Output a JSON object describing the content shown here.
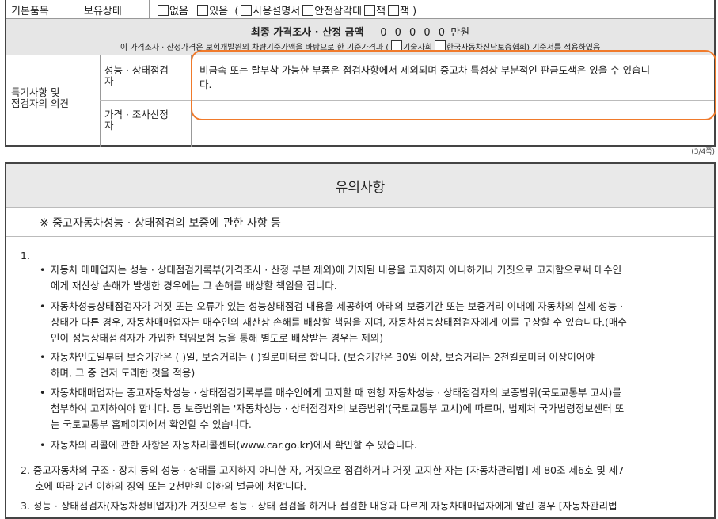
{
  "row1": {
    "label": "기본품목",
    "sublabel": "보유상태",
    "opt_none": "없음",
    "opt_have": "있음",
    "paren_open": "(",
    "item_manual": "사용설명서",
    "item_triangle": "안전삼각대",
    "item_jack": "잭",
    "item_jack2": "잭",
    "paren_close": ")"
  },
  "price": {
    "title": "최종 가격조사 · 산정 금액",
    "amount": "0 0 0 0 0",
    "unit": "만원",
    "note_prefix": "이 가격조사 · 산정가격은 보험개발원의 차량기준가액을 바탕으로 한 기준가격과 (",
    "opt_tech": "기술사회",
    "opt_assoc": "한국자동차진단보증협회",
    "note_suffix": ") 기준서를 적용하였음"
  },
  "special": {
    "label_line1": "특기사항 및",
    "label_line2": "점검자의 의견",
    "perf_label_line1": "성능 · 상태점검",
    "perf_label_line2": "자",
    "perf_text_line1": "비금속 또는 탈부착 가능한 부품은 점검사항에서 제외되며 중고차 특성상 부분적인 판금도색은 있을 수 있습니",
    "perf_text_line2": "다.",
    "price_label_line1": "가격 · 조사산정",
    "price_label_line2": "자",
    "price_text": ""
  },
  "page_num": "(3/4쪽)",
  "notice": {
    "title": "유의사항",
    "subtitle": "※ 중고자동차성능 · 상태점검의 보증에 관한 사항 등",
    "n1": "1.",
    "b1_l1": "자동차 매매업자는 성능 · 상태점검기록부(가격조사 · 산정 부분 제외)에 기재된 내용을 고지하지 아니하거나 거짓으로 고지함으로써 매수인",
    "b1_l2": "에게 재산상 손해가 발생한 경우에는 그 손해를 배상할 책임을 집니다.",
    "b2_l1": "자동차성능상태점검자가 거짓 또는 오류가 있는 성능상태점검 내용을 제공하여 아래의 보증기간 또는 보증거리 이내에 자동차의 실제 성능 ·",
    "b2_l2": "상태가 다른 경우, 자동차매매업자는 매수인의 재산상 손해를 배상할 책임을 지며, 자동차성능상태점검자에게 이를 구상할 수 있습니다.(매수",
    "b2_l3": "인이 성능상태점검자가 가입한 책임보험 등을 통해 별도로 배상받는 경우는 제외)",
    "b3_l1": "자동차인도일부터 보증기간은 (      )일, 보증거리는 (      )킬로미터로 합니다. (보증기간은 30일 이상, 보증거리는 2천킬로미터 이상이어야",
    "b3_l2": "하며, 그 중 먼저 도래한 것을 적용)",
    "b4_l1": "자동차매매업자는 중고자동차성능 · 상태점검기록부를 매수인에게 고지할 때 현행 자동차성능 · 상태점검자의 보증범위(국토교통부 고시)를",
    "b4_l2": "첨부하여 고지하여야 합니다. 동 보증범위는 '자동차성능 · 상태점검자의 보증범위'(국토교통부 고시)에 따르며, 법제처 국가법령정보센터 또",
    "b4_l3": "는 국토교통부 홈페이지에서 확인할 수 있습니다.",
    "b5_l1": "자동차의 리콜에 관한 사항은 자동차리콜센터(www.car.go.kr)에서 확인할 수 있습니다.",
    "n2_l1": "2.  중고자동차의 구조 · 장치 등의 성능 · 상태를 고지하지 아니한 자, 거짓으로 점검하거나 거짓 고지한 자는 [자동차관리법] 제 80조 제6호 및 제7",
    "n2_l2": "호에 따라 2년 이하의 징역 또는 2천만원 이하의 벌금에 처합니다.",
    "n3_l1": "3.  성능 · 상태점검자(자동차정비업자)가 거짓으로 성능 · 상태 점검을 하거나 점검한 내용과 다르게 자동차매매업자에게 알린 경우 [자동차관리법",
    "bullet": "•"
  }
}
